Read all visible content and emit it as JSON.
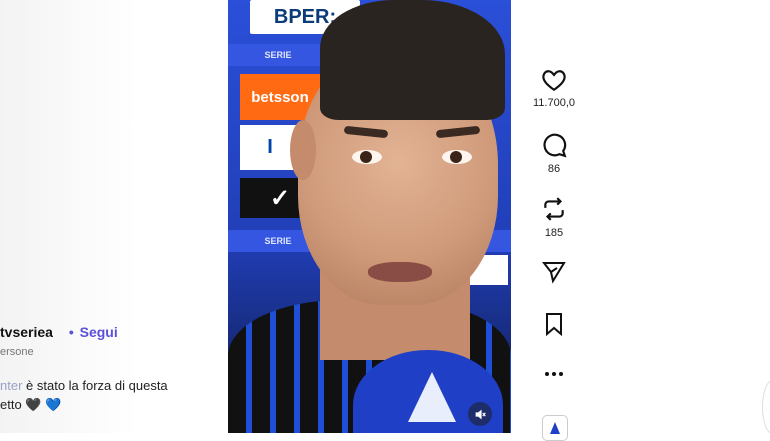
{
  "post": {
    "username": "tvseriea",
    "follow_dot": "•",
    "follow_label": "Segui",
    "audio_text": "ersone",
    "caption_muted": "nter",
    "caption_line1": " è stato la forza di questa",
    "caption_line2": "etto",
    "heart_black": "🖤",
    "heart_blue": "💙"
  },
  "video": {
    "board_bper": "BPER:",
    "board_serie": "SERIE",
    "board_betsson": "betsson",
    "board_inter": "I",
    "board_nike": "✓"
  },
  "actions": {
    "likes": "11.700,0",
    "comments": "86",
    "reposts": "185"
  },
  "colors": {
    "accent": "#5b51d8",
    "serie_blue": "#1f3fc7"
  }
}
